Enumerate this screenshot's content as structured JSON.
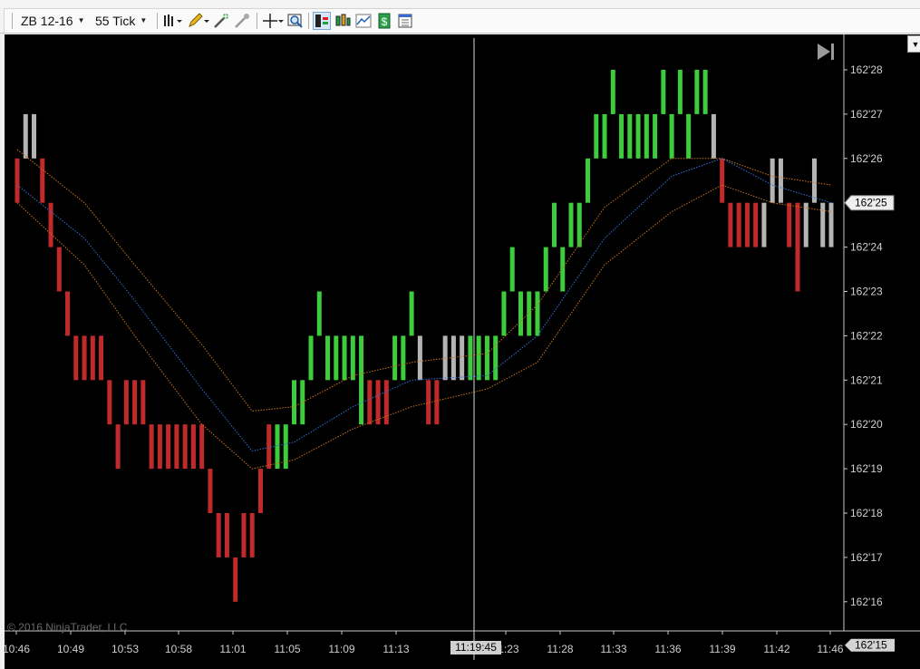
{
  "toolbar": {
    "instrument": "ZB 12-16",
    "interval": "55 Tick"
  },
  "chart_data": {
    "type": "bar",
    "title": "",
    "price_labels": [
      "162'28",
      "162'27",
      "162'26",
      "162'25",
      "162'24",
      "162'23",
      "162'22",
      "162'21",
      "162'20",
      "162'19",
      "162'18",
      "162'17",
      "162'16",
      "162'15"
    ],
    "time_labels": [
      "10:46",
      "10:49",
      "10:53",
      "10:58",
      "11:01",
      "11:05",
      "11:09",
      "11:13",
      "11:23",
      "11:28",
      "11:33",
      "11:36",
      "11:39",
      "11:42",
      "11:46"
    ],
    "ylim_32nds": [
      15,
      28.5
    ],
    "current_price_label": "162'25",
    "bottom_price_label": "162'15",
    "cursor_time_label": "11:19:45",
    "copyright": "© 2016 NinjaTrader, LLC",
    "colors": {
      "up": "#3ccc3c",
      "down": "#c02a2a",
      "neutral": "#b4b4b4",
      "ema_fast": "#2f6fd6",
      "envelope": "#c8731a"
    },
    "bars": [
      {
        "high": 26,
        "low": 25,
        "dir": "down"
      },
      {
        "high": 27,
        "low": 26,
        "dir": "neutral"
      },
      {
        "high": 27,
        "low": 26,
        "dir": "neutral"
      },
      {
        "high": 26,
        "low": 25,
        "dir": "down"
      },
      {
        "high": 25,
        "low": 24,
        "dir": "down"
      },
      {
        "high": 24,
        "low": 23,
        "dir": "down"
      },
      {
        "high": 23,
        "low": 22,
        "dir": "down"
      },
      {
        "high": 22,
        "low": 21,
        "dir": "down"
      },
      {
        "high": 22,
        "low": 21,
        "dir": "down"
      },
      {
        "high": 22,
        "low": 21,
        "dir": "down"
      },
      {
        "high": 22,
        "low": 21,
        "dir": "down"
      },
      {
        "high": 21,
        "low": 20,
        "dir": "down"
      },
      {
        "high": 20,
        "low": 19,
        "dir": "down"
      },
      {
        "high": 21,
        "low": 20,
        "dir": "down"
      },
      {
        "high": 21,
        "low": 20,
        "dir": "down"
      },
      {
        "high": 21,
        "low": 20,
        "dir": "down"
      },
      {
        "high": 20,
        "low": 19,
        "dir": "down"
      },
      {
        "high": 20,
        "low": 19,
        "dir": "down"
      },
      {
        "high": 20,
        "low": 19,
        "dir": "down"
      },
      {
        "high": 20,
        "low": 19,
        "dir": "down"
      },
      {
        "high": 20,
        "low": 19,
        "dir": "down"
      },
      {
        "high": 20,
        "low": 19,
        "dir": "down"
      },
      {
        "high": 20,
        "low": 19,
        "dir": "down"
      },
      {
        "high": 19,
        "low": 18,
        "dir": "down"
      },
      {
        "high": 18,
        "low": 17,
        "dir": "down"
      },
      {
        "high": 18,
        "low": 17,
        "dir": "down"
      },
      {
        "high": 17,
        "low": 16,
        "dir": "down"
      },
      {
        "high": 18,
        "low": 17,
        "dir": "down"
      },
      {
        "high": 18,
        "low": 17,
        "dir": "down"
      },
      {
        "high": 19,
        "low": 18,
        "dir": "down"
      },
      {
        "high": 20,
        "low": 19,
        "dir": "down"
      },
      {
        "high": 20,
        "low": 19,
        "dir": "up"
      },
      {
        "high": 20,
        "low": 19,
        "dir": "up"
      },
      {
        "high": 21,
        "low": 20,
        "dir": "up"
      },
      {
        "high": 21,
        "low": 20,
        "dir": "up"
      },
      {
        "high": 22,
        "low": 21,
        "dir": "up"
      },
      {
        "high": 23,
        "low": 22,
        "dir": "up"
      },
      {
        "high": 22,
        "low": 21,
        "dir": "up"
      },
      {
        "high": 22,
        "low": 21,
        "dir": "up"
      },
      {
        "high": 22,
        "low": 21,
        "dir": "up"
      },
      {
        "high": 22,
        "low": 21,
        "dir": "up"
      },
      {
        "high": 22,
        "low": 20,
        "dir": "up"
      },
      {
        "high": 21,
        "low": 20,
        "dir": "down"
      },
      {
        "high": 21,
        "low": 20,
        "dir": "down"
      },
      {
        "high": 21,
        "low": 20,
        "dir": "down"
      },
      {
        "high": 22,
        "low": 21,
        "dir": "up"
      },
      {
        "high": 22,
        "low": 21,
        "dir": "up"
      },
      {
        "high": 23,
        "low": 22,
        "dir": "up"
      },
      {
        "high": 22,
        "low": 21,
        "dir": "neutral"
      },
      {
        "high": 21,
        "low": 20,
        "dir": "down"
      },
      {
        "high": 21,
        "low": 20,
        "dir": "down"
      },
      {
        "high": 22,
        "low": 21,
        "dir": "neutral"
      },
      {
        "high": 22,
        "low": 21,
        "dir": "neutral"
      },
      {
        "high": 22,
        "low": 21,
        "dir": "neutral"
      },
      {
        "high": 22,
        "low": 21,
        "dir": "up"
      },
      {
        "high": 22,
        "low": 21,
        "dir": "up"
      },
      {
        "high": 22,
        "low": 21,
        "dir": "up"
      },
      {
        "high": 22,
        "low": 21,
        "dir": "up"
      },
      {
        "high": 23,
        "low": 22,
        "dir": "up"
      },
      {
        "high": 24,
        "low": 23,
        "dir": "up"
      },
      {
        "high": 23,
        "low": 22,
        "dir": "up"
      },
      {
        "high": 23,
        "low": 22,
        "dir": "up"
      },
      {
        "high": 23,
        "low": 22,
        "dir": "up"
      },
      {
        "high": 24,
        "low": 23,
        "dir": "up"
      },
      {
        "high": 25,
        "low": 24,
        "dir": "up"
      },
      {
        "high": 24,
        "low": 23,
        "dir": "up"
      },
      {
        "high": 25,
        "low": 24,
        "dir": "up"
      },
      {
        "high": 25,
        "low": 24,
        "dir": "up"
      },
      {
        "high": 26,
        "low": 25,
        "dir": "up"
      },
      {
        "high": 27,
        "low": 26,
        "dir": "up"
      },
      {
        "high": 27,
        "low": 26,
        "dir": "up"
      },
      {
        "high": 28,
        "low": 27,
        "dir": "up"
      },
      {
        "high": 27,
        "low": 26,
        "dir": "up"
      },
      {
        "high": 27,
        "low": 26,
        "dir": "up"
      },
      {
        "high": 27,
        "low": 26,
        "dir": "up"
      },
      {
        "high": 27,
        "low": 26,
        "dir": "up"
      },
      {
        "high": 27,
        "low": 26,
        "dir": "up"
      },
      {
        "high": 28,
        "low": 27,
        "dir": "up"
      },
      {
        "high": 27,
        "low": 26,
        "dir": "up"
      },
      {
        "high": 28,
        "low": 27,
        "dir": "up"
      },
      {
        "high": 27,
        "low": 26,
        "dir": "up"
      },
      {
        "high": 28,
        "low": 27,
        "dir": "up"
      },
      {
        "high": 28,
        "low": 27,
        "dir": "up"
      },
      {
        "high": 27,
        "low": 26,
        "dir": "neutral"
      },
      {
        "high": 26,
        "low": 25,
        "dir": "down"
      },
      {
        "high": 25,
        "low": 24,
        "dir": "down"
      },
      {
        "high": 25,
        "low": 24,
        "dir": "down"
      },
      {
        "high": 25,
        "low": 24,
        "dir": "down"
      },
      {
        "high": 25,
        "low": 24,
        "dir": "down"
      },
      {
        "high": 25,
        "low": 24,
        "dir": "neutral"
      },
      {
        "high": 26,
        "low": 25,
        "dir": "neutral"
      },
      {
        "high": 26,
        "low": 25,
        "dir": "neutral"
      },
      {
        "high": 25,
        "low": 24,
        "dir": "down"
      },
      {
        "high": 25,
        "low": 23,
        "dir": "down"
      },
      {
        "high": 25,
        "low": 24,
        "dir": "neutral"
      },
      {
        "high": 26,
        "low": 25,
        "dir": "neutral"
      },
      {
        "high": 25,
        "low": 24,
        "dir": "neutral"
      },
      {
        "high": 25,
        "low": 24,
        "dir": "neutral"
      }
    ],
    "ema_fast": [
      [
        0,
        25.4
      ],
      [
        8,
        24.2
      ],
      [
        14,
        22.8
      ],
      [
        22,
        20.8
      ],
      [
        28,
        19.4
      ],
      [
        33,
        19.6
      ],
      [
        40,
        20.4
      ],
      [
        47,
        21.0
      ],
      [
        56,
        21.1
      ],
      [
        62,
        22.0
      ],
      [
        70,
        24.2
      ],
      [
        78,
        25.6
      ],
      [
        84,
        26.0
      ],
      [
        90,
        25.4
      ],
      [
        97,
        25.0
      ]
    ],
    "envelope_upper": [
      [
        0,
        26.2
      ],
      [
        8,
        25.0
      ],
      [
        14,
        23.6
      ],
      [
        22,
        21.8
      ],
      [
        28,
        20.3
      ],
      [
        33,
        20.4
      ],
      [
        40,
        21.1
      ],
      [
        47,
        21.4
      ],
      [
        56,
        21.6
      ],
      [
        62,
        22.7
      ],
      [
        70,
        24.9
      ],
      [
        78,
        26.0
      ],
      [
        84,
        26.0
      ],
      [
        90,
        25.6
      ],
      [
        97,
        25.4
      ]
    ],
    "envelope_lower": [
      [
        0,
        25.0
      ],
      [
        8,
        23.6
      ],
      [
        14,
        22.0
      ],
      [
        22,
        20.0
      ],
      [
        28,
        19.0
      ],
      [
        33,
        19.2
      ],
      [
        40,
        19.9
      ],
      [
        47,
        20.4
      ],
      [
        56,
        20.8
      ],
      [
        62,
        21.4
      ],
      [
        70,
        23.6
      ],
      [
        78,
        24.8
      ],
      [
        84,
        25.4
      ],
      [
        90,
        25.0
      ],
      [
        97,
        24.8
      ]
    ]
  }
}
